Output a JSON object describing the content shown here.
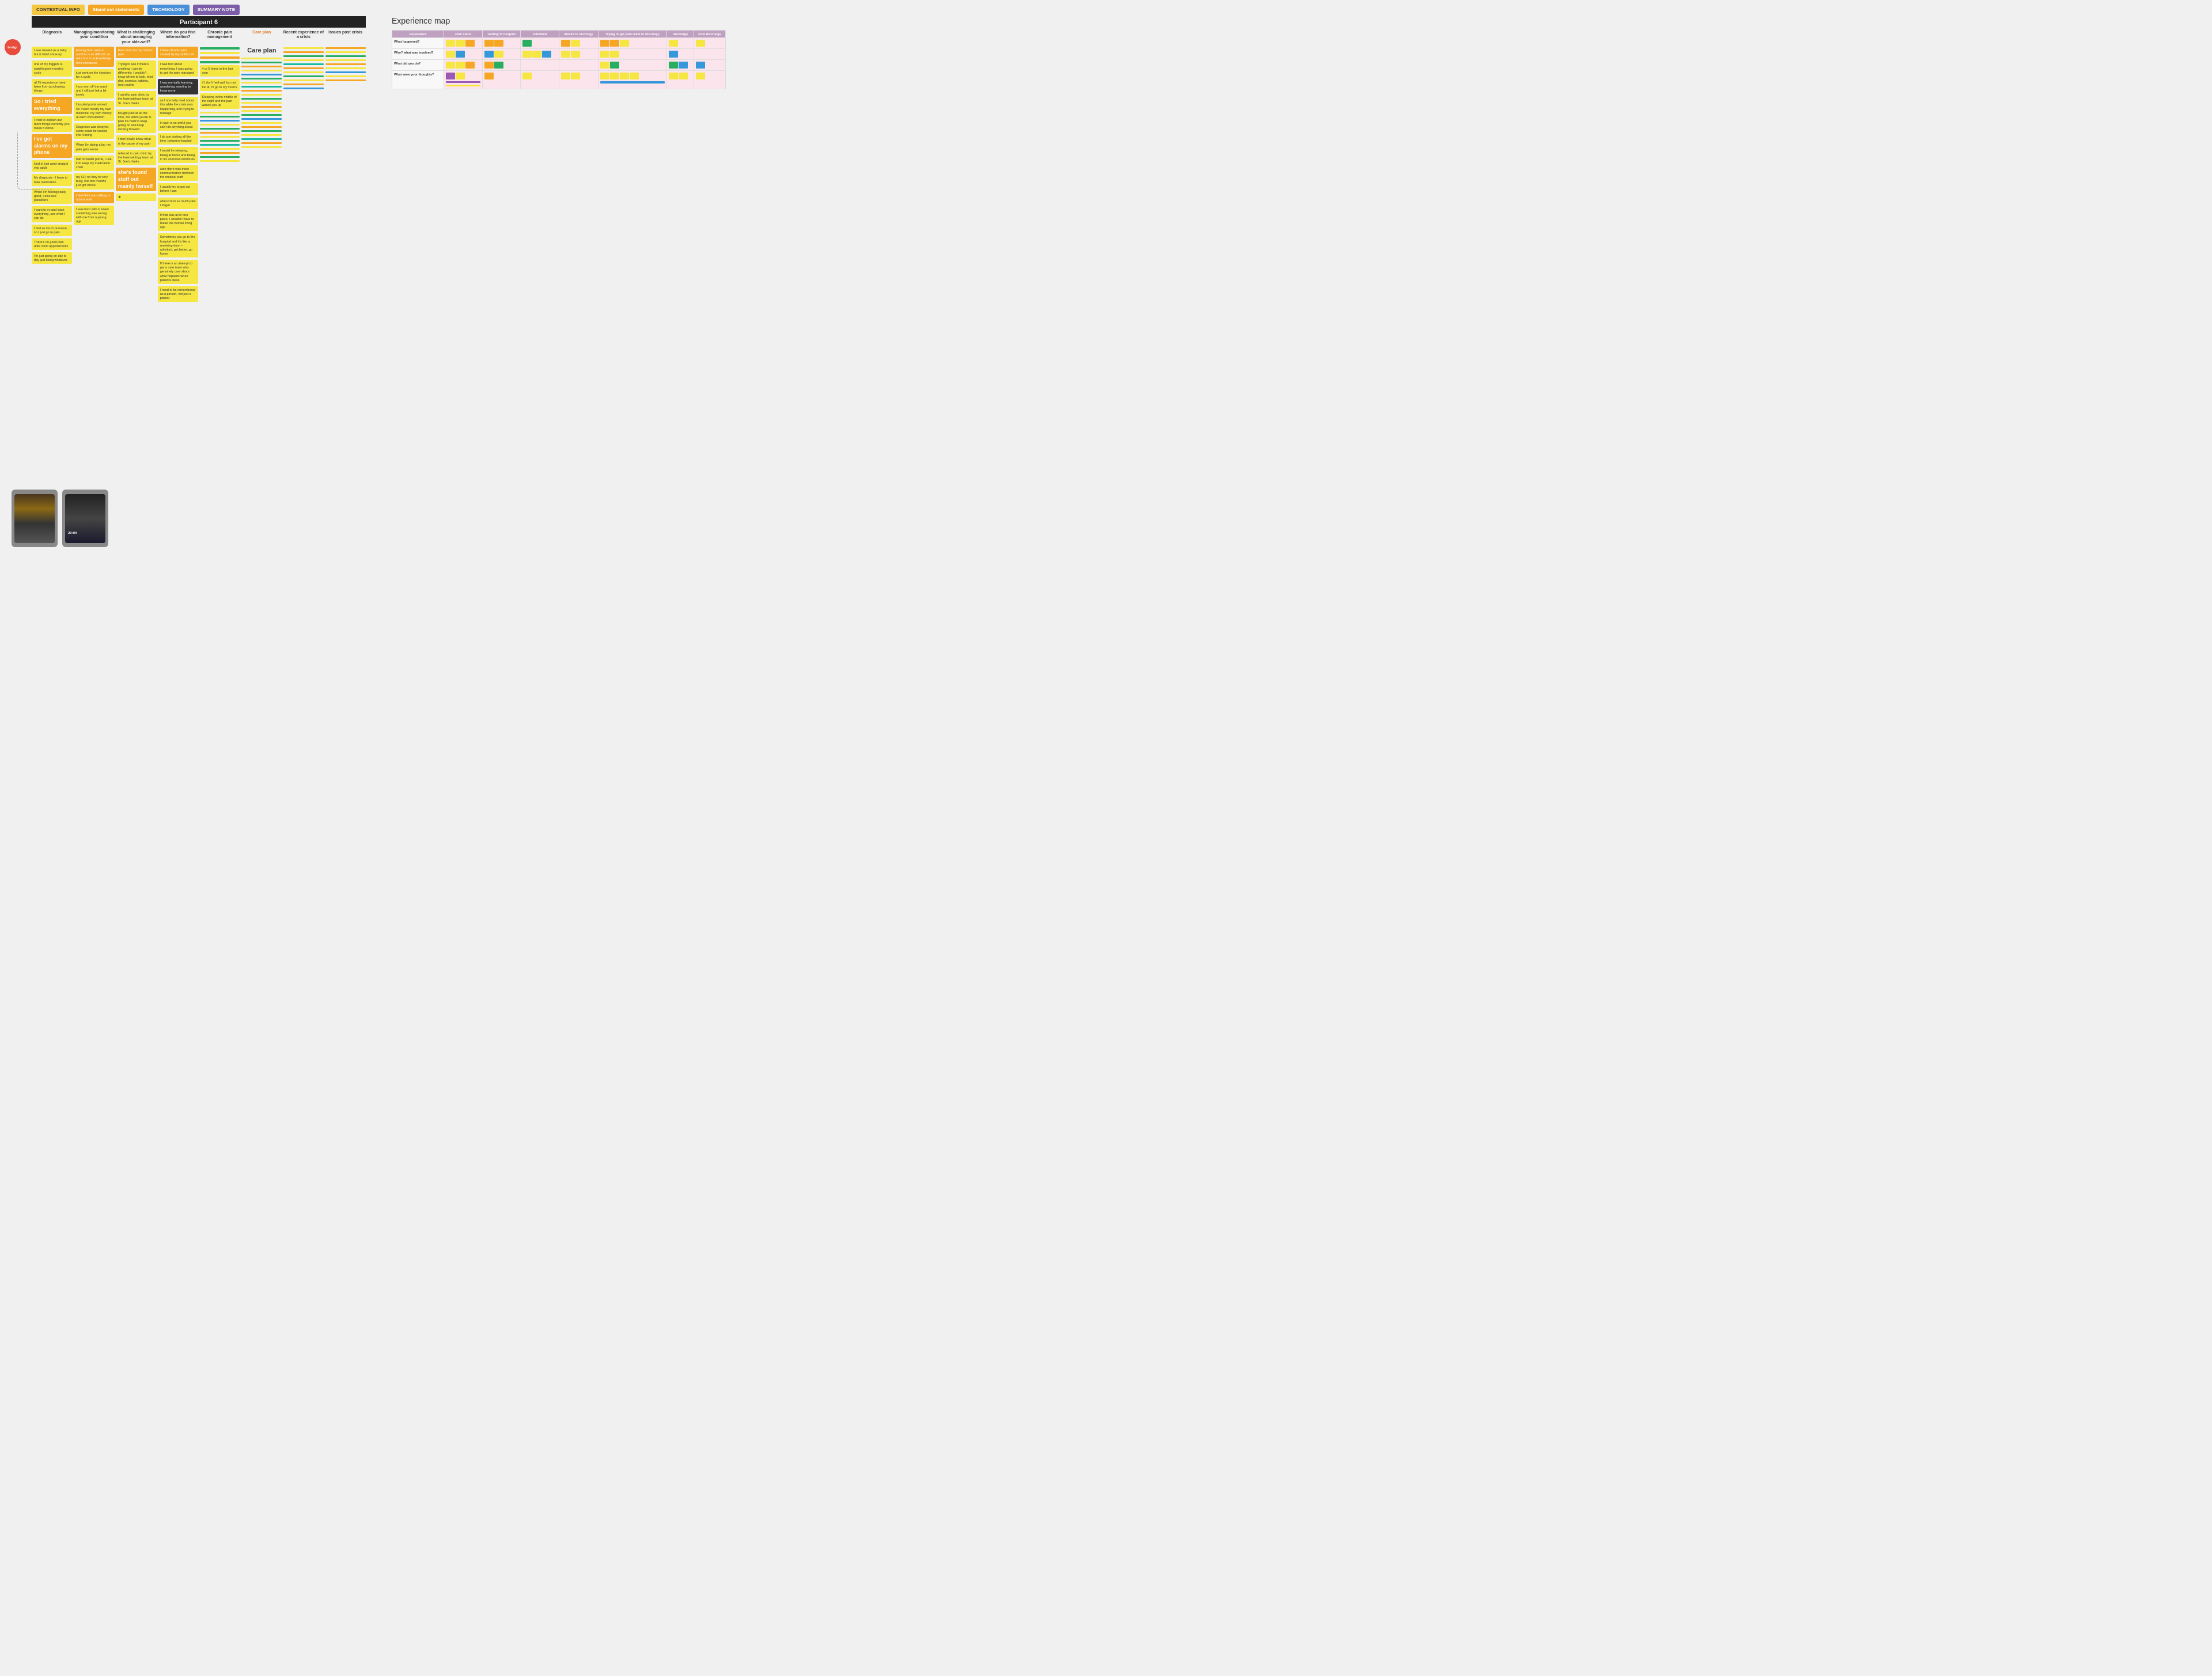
{
  "tags": [
    {
      "label": "CONTEXTUAL INFO",
      "class": "tag-contextual"
    },
    {
      "label": "Stand out statements",
      "class": "tag-standout"
    },
    {
      "label": "TECHNOLOGY",
      "class": "tag-technology"
    },
    {
      "label": "SUMMARY NOTE",
      "class": "tag-summary"
    }
  ],
  "participant": {
    "title": "Participant 6"
  },
  "columns": [
    {
      "label": "Diagnosis",
      "highlight": false
    },
    {
      "label": "Managing/monitoring your condition",
      "highlight": false
    },
    {
      "label": "What is challenging about managing your side-self?",
      "highlight": false
    },
    {
      "label": "Where do you find information?",
      "highlight": false
    },
    {
      "label": "Chronic pain management",
      "highlight": false
    },
    {
      "label": "Care plan",
      "highlight": true
    },
    {
      "label": "Recent experience of a crisis",
      "highlight": false
    },
    {
      "label": "Issues post crisis",
      "highlight": false
    }
  ],
  "experience_map": {
    "title": "Experience map",
    "headers": [
      "Experience",
      "Pain starts",
      "Getting to hospital",
      "Admitted",
      "Moved to oncology",
      "Trying to get pain relief in Oncology",
      "Discharge",
      "Post discharge"
    ],
    "rows": [
      {
        "label": "What happened?",
        "cells": [
          {
            "color": "#fce4ec",
            "items": []
          },
          {
            "color": "#fce4ec",
            "items": [
              "yellow",
              "yellow",
              "orange"
            ]
          },
          {
            "color": "#fce4ec",
            "items": [
              "orange",
              "orange"
            ]
          },
          {
            "color": "#fce4ec",
            "items": [
              "green"
            ]
          },
          {
            "color": "#fce4ec",
            "items": [
              "orange",
              "yellow"
            ]
          },
          {
            "color": "#fce4ec",
            "items": [
              "orange",
              "orange",
              "yellow"
            ]
          },
          {
            "color": "#fce4ec",
            "items": [
              "yellow"
            ]
          },
          {
            "color": "#fce4ec",
            "items": [
              "yellow"
            ]
          }
        ]
      },
      {
        "label": "Who? what was involved?",
        "cells": [
          {
            "color": "#fce4ec",
            "items": []
          },
          {
            "color": "#fce4ec",
            "items": [
              "yellow",
              "blue"
            ]
          },
          {
            "color": "#fce4ec",
            "items": [
              "blue",
              "yellow"
            ]
          },
          {
            "color": "#fce4ec",
            "items": [
              "yellow",
              "yellow",
              "blue"
            ]
          },
          {
            "color": "#fce4ec",
            "items": [
              "yellow",
              "yellow"
            ]
          },
          {
            "color": "#fce4ec",
            "items": [
              "yellow",
              "yellow"
            ]
          },
          {
            "color": "#fce4ec",
            "items": [
              "blue"
            ]
          },
          {
            "color": "#fce4ec",
            "items": []
          }
        ]
      },
      {
        "label": "What did you do?",
        "cells": [
          {
            "color": "#fce4ec",
            "items": []
          },
          {
            "color": "#fce4ec",
            "items": [
              "yellow",
              "yellow",
              "orange"
            ]
          },
          {
            "color": "#fce4ec",
            "items": [
              "orange",
              "green"
            ]
          },
          {
            "color": "#fce4ec",
            "items": []
          },
          {
            "color": "#fce4ec",
            "items": []
          },
          {
            "color": "#fce4ec",
            "items": [
              "yellow",
              "green"
            ]
          },
          {
            "color": "#fce4ec",
            "items": [
              "green",
              "blue"
            ]
          },
          {
            "color": "#fce4ec",
            "items": [
              "blue"
            ]
          }
        ]
      },
      {
        "label": "What were your thoughts?",
        "cells": [
          {
            "color": "#fce4ec",
            "items": []
          },
          {
            "color": "#fce4ec",
            "items": [
              "purple",
              "yellow"
            ]
          },
          {
            "color": "#fce4ec",
            "items": [
              "orange"
            ]
          },
          {
            "color": "#fce4ec",
            "items": [
              "yellow"
            ]
          },
          {
            "color": "#fce4ec",
            "items": [
              "yellow",
              "yellow"
            ]
          },
          {
            "color": "#fce4ec",
            "items": [
              "yellow",
              "yellow",
              "yellow",
              "yellow"
            ]
          },
          {
            "color": "#fce4ec",
            "items": [
              "yellow",
              "yellow"
            ]
          },
          {
            "color": "#fce4ec",
            "items": [
              "yellow"
            ]
          }
        ]
      }
    ]
  },
  "stand_out_notes": [
    "I was treated as a baby but it didn't show up",
    "one of my triggers is watching my monthly cycle",
    "all I'd experience have been from purchasing things online",
    "So I tried everything",
    "I just won off the ward and I still just felt a bit lonely",
    "I've got alarms on my phone",
    "kind of just went straight into adult",
    "she's found stuff out mainly herself",
    "when I'm in so much pain I forget",
    "wish there was more communication between the medical staff",
    "I usually try to get out before I can",
    "If that was all in one place, I wouldn't have to dread the human living app",
    "4 or 5 times in the last year",
    "if I don't feel well but not too ill, I'll go to my mum's",
    "I did just visiting all the time between hospital",
    "I would be sleeping, being at home and being in it's unknown territories",
    "Sleeping in the middle of the night and the pain wakes you up"
  ],
  "care_plan_label": "Care plan",
  "bottom_images": [
    {
      "label": "Phone photo 1"
    },
    {
      "label": "Phone photo 2"
    }
  ]
}
